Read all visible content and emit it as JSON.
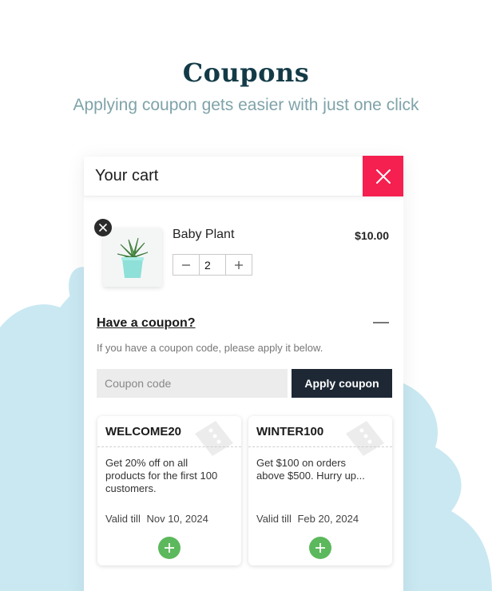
{
  "hero": {
    "title": "Coupons",
    "subtitle": "Applying coupon gets easier with just one click"
  },
  "cart": {
    "title": "Your cart",
    "close_icon": "close-icon",
    "item": {
      "name": "Baby Plant",
      "price": "$10.00",
      "quantity": "2",
      "remove_icon": "close-icon",
      "image": "potted-succulent"
    },
    "coupon": {
      "heading": "Have a coupon?",
      "hint": "If you have a coupon code, please apply it below.",
      "input_placeholder": "Coupon code",
      "apply_label": "Apply coupon"
    },
    "offers": [
      {
        "code": "WELCOME20",
        "description": "Get 20% off on all products for the first 100 customers.",
        "valid_label": "Valid till",
        "valid_date": "Nov 10, 2024"
      },
      {
        "code": "WINTER100",
        "description": "Get $100 on orders above $500. Hurry up...",
        "valid_label": "Valid till",
        "valid_date": "Feb 20, 2024"
      }
    ]
  },
  "colors": {
    "title": "#133b47",
    "subtitle": "#7fa3a9",
    "close_bg": "#f51f50",
    "apply_bg": "#1e2835",
    "add_green": "#5cb85c",
    "blob": "#c9e8f2"
  }
}
